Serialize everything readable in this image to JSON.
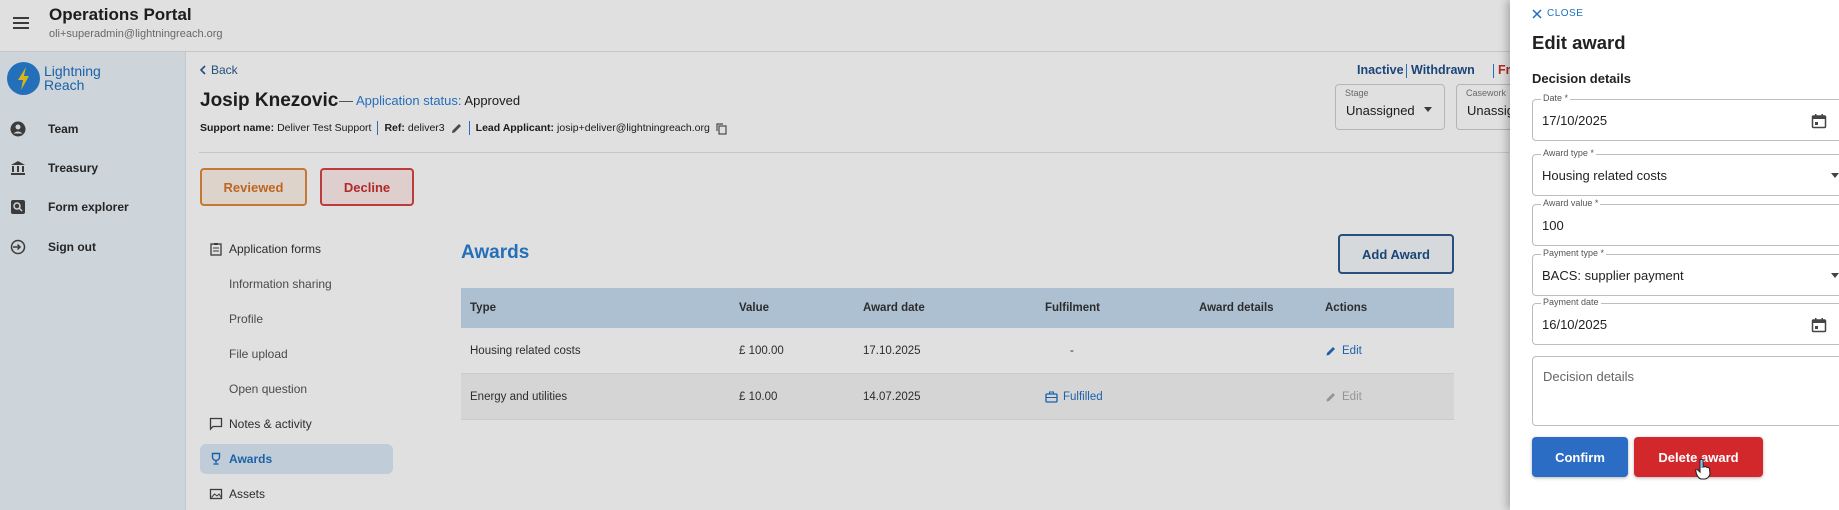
{
  "app": {
    "title": "Operations Portal",
    "user_email": "oli+superadmin@lightningreach.org",
    "logo_text": "Lightning Reach"
  },
  "sidebar": {
    "items": [
      {
        "label": "Team",
        "icon": "person-icon"
      },
      {
        "label": "Treasury",
        "icon": "bank-icon"
      },
      {
        "label": "Form explorer",
        "icon": "search-icon"
      },
      {
        "label": "Sign out",
        "icon": "logout-icon"
      }
    ]
  },
  "application": {
    "back_label": "Back",
    "name": "Josip Knezovic",
    "dash": "—",
    "status_label": "Application status:",
    "status_value": "Approved",
    "support_name_label": "Support name:",
    "support_name": "Deliver Test Support",
    "ref_label": "Ref:",
    "ref": "deliver3",
    "lead_label": "Lead Applicant:",
    "lead_email": "josip+deliver@lightningreach.org",
    "reviewed_label": "Reviewed",
    "decline_label": "Decline",
    "header_statuses": [
      "Inactive",
      "Withdrawn",
      "Fr"
    ],
    "stage_label": "Stage",
    "stage_value": "Unassigned",
    "casework_label": "Casework",
    "casework_value": "Unassig"
  },
  "section_nav": [
    {
      "label": "Application forms",
      "icon": "clipboard-icon",
      "sub": false,
      "active": false
    },
    {
      "label": "Information sharing",
      "sub": true,
      "active": false
    },
    {
      "label": "Profile",
      "sub": true,
      "active": false
    },
    {
      "label": "File upload",
      "sub": true,
      "active": false
    },
    {
      "label": "Open question",
      "sub": true,
      "active": false
    },
    {
      "label": "Notes & activity",
      "icon": "chat-icon",
      "sub": false,
      "active": false
    },
    {
      "label": "Awards",
      "icon": "trophy-icon",
      "sub": false,
      "active": true
    },
    {
      "label": "Assets",
      "icon": "image-icon",
      "sub": false,
      "active": false
    }
  ],
  "awards": {
    "title": "Awards",
    "add_label": "Add Award",
    "columns": [
      "Type",
      "Value",
      "Award date",
      "Fulfilment",
      "Award details",
      "Actions"
    ],
    "rows": [
      {
        "type": "Housing related costs",
        "value": "£ 100.00",
        "date": "17.10.2025",
        "fulfilment": "-",
        "details": "",
        "action": "Edit"
      },
      {
        "type": "Energy and utilities",
        "value": "£ 10.00",
        "date": "14.07.2025",
        "fulfilment": "Fulfilled",
        "details": "",
        "action": "Edit"
      }
    ]
  },
  "drawer": {
    "close_label": "CLOSE",
    "title": "Edit award",
    "section_title": "Decision details",
    "fields": {
      "date": {
        "label": "Date *",
        "value": "17/10/2025"
      },
      "award_type": {
        "label": "Award type *",
        "value": "Housing related costs"
      },
      "award_value": {
        "label": "Award value *",
        "value": "100"
      },
      "payment_type": {
        "label": "Payment type *",
        "value": "BACS: supplier payment"
      },
      "payment_date": {
        "label": "Payment date",
        "value": "16/10/2025"
      }
    },
    "decision_placeholder": "Decision details",
    "confirm_label": "Confirm",
    "delete_label": "Delete award"
  },
  "colors": {
    "primary": "#2a7fd4",
    "confirm": "#2b6cc4",
    "danger": "#d3282b",
    "reviewed": "#e0893a"
  }
}
